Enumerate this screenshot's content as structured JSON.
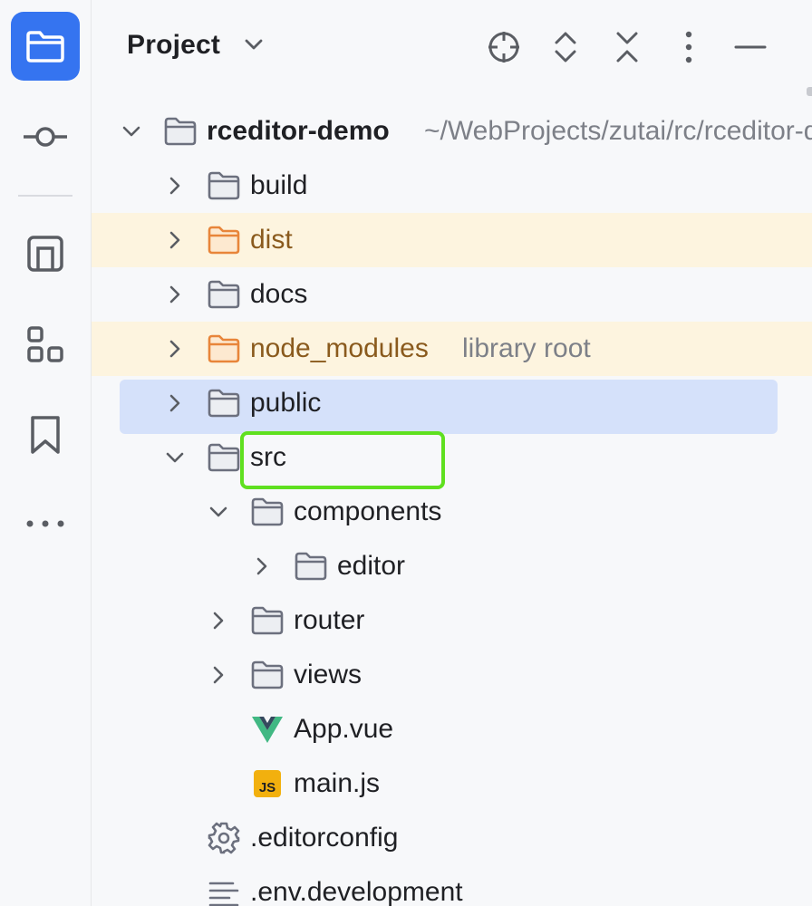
{
  "toolstrip": {
    "items": [
      {
        "name": "project",
        "icon": "folder-icon",
        "active": true
      },
      {
        "name": "commit",
        "icon": "commit-icon"
      },
      {
        "name": "structure",
        "icon": "structure-icon"
      },
      {
        "name": "plugins",
        "icon": "modules-icon"
      },
      {
        "name": "bookmarks",
        "icon": "bookmark-icon"
      },
      {
        "name": "more",
        "icon": "more-icon"
      }
    ]
  },
  "panel": {
    "title": "Project",
    "actions": [
      "locate-icon",
      "expand-icon",
      "collapse-icon",
      "more-vertical-icon",
      "minimize-icon"
    ]
  },
  "tree": {
    "root": {
      "label": "rceditor-demo",
      "path": "~/WebProjects/zutai/rc/rceditor-demo"
    },
    "items": [
      {
        "label": "build"
      },
      {
        "label": "dist"
      },
      {
        "label": "docs"
      },
      {
        "label": "node_modules",
        "hint": "library root"
      },
      {
        "label": "public"
      },
      {
        "label": "src"
      },
      {
        "label": "components"
      },
      {
        "label": "editor"
      },
      {
        "label": "router"
      },
      {
        "label": "views"
      },
      {
        "label": "App.vue"
      },
      {
        "label": "main.js",
        "badge": "JS"
      },
      {
        "label": ".editorconfig"
      },
      {
        "label": ".env.development"
      }
    ]
  },
  "colors": {
    "accent": "#3574f0",
    "selection": "#d5e1fa",
    "library_row": "#fdf4df",
    "highlight": "#5fe01f"
  }
}
